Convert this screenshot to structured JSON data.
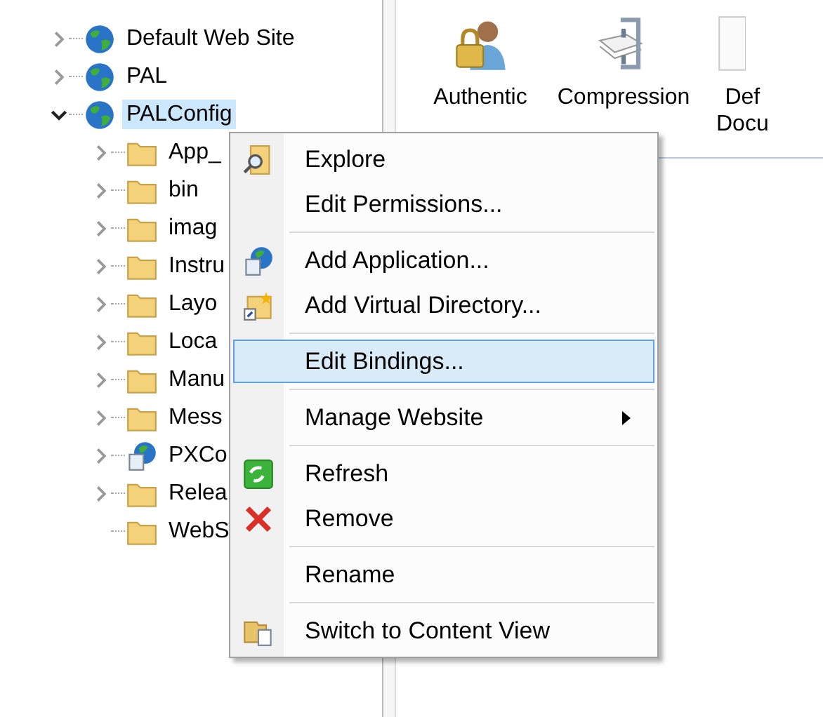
{
  "tree": {
    "items": [
      {
        "label": "Default Web Site",
        "kind": "site",
        "expanded": false,
        "selected": false
      },
      {
        "label": "PAL",
        "kind": "site",
        "expanded": false,
        "selected": false
      },
      {
        "label": "PALConfig",
        "kind": "site",
        "expanded": true,
        "selected": true,
        "children": [
          {
            "label": "App_",
            "kind": "folder",
            "expanded": false,
            "selected": false
          },
          {
            "label": "bin",
            "kind": "folder",
            "expanded": false,
            "selected": false
          },
          {
            "label": "imag",
            "kind": "folder",
            "expanded": false,
            "selected": false
          },
          {
            "label": "Instru",
            "kind": "folder",
            "expanded": false,
            "selected": false
          },
          {
            "label": "Layo",
            "kind": "folder",
            "expanded": false,
            "selected": false
          },
          {
            "label": "Loca",
            "kind": "folder",
            "expanded": false,
            "selected": false
          },
          {
            "label": "Manu",
            "kind": "folder",
            "expanded": false,
            "selected": false
          },
          {
            "label": "Mess",
            "kind": "folder",
            "expanded": false,
            "selected": false
          },
          {
            "label": "PXCo",
            "kind": "application",
            "expanded": false,
            "selected": false
          },
          {
            "label": "Relea",
            "kind": "folder",
            "expanded": false,
            "selected": false
          },
          {
            "label": "WebS",
            "kind": "folder",
            "selected": false
          }
        ]
      }
    ]
  },
  "features": [
    {
      "lines": [
        "Authentic"
      ]
    },
    {
      "lines": [
        "Compression"
      ]
    },
    {
      "lines": [
        "Def",
        "Docu"
      ]
    }
  ],
  "context_menu": {
    "items": [
      {
        "kind": "item",
        "label": "Explore",
        "selected": false,
        "submenu": false
      },
      {
        "kind": "item",
        "label": "Edit Permissions...",
        "selected": false,
        "submenu": false
      },
      {
        "kind": "separator"
      },
      {
        "kind": "item",
        "label": "Add Application...",
        "selected": false,
        "submenu": false
      },
      {
        "kind": "item",
        "label": "Add Virtual Directory...",
        "selected": false,
        "submenu": false
      },
      {
        "kind": "separator"
      },
      {
        "kind": "item",
        "label": "Edit Bindings...",
        "selected": true,
        "submenu": false
      },
      {
        "kind": "separator"
      },
      {
        "kind": "item",
        "label": "Manage Website",
        "selected": false,
        "submenu": true
      },
      {
        "kind": "separator"
      },
      {
        "kind": "item",
        "label": "Refresh",
        "selected": false,
        "submenu": false
      },
      {
        "kind": "item",
        "label": "Remove",
        "selected": false,
        "submenu": false
      },
      {
        "kind": "separator"
      },
      {
        "kind": "item",
        "label": "Rename",
        "selected": false,
        "submenu": false
      },
      {
        "kind": "separator"
      },
      {
        "kind": "item",
        "label": "Switch to Content View",
        "selected": false,
        "submenu": false
      }
    ]
  }
}
